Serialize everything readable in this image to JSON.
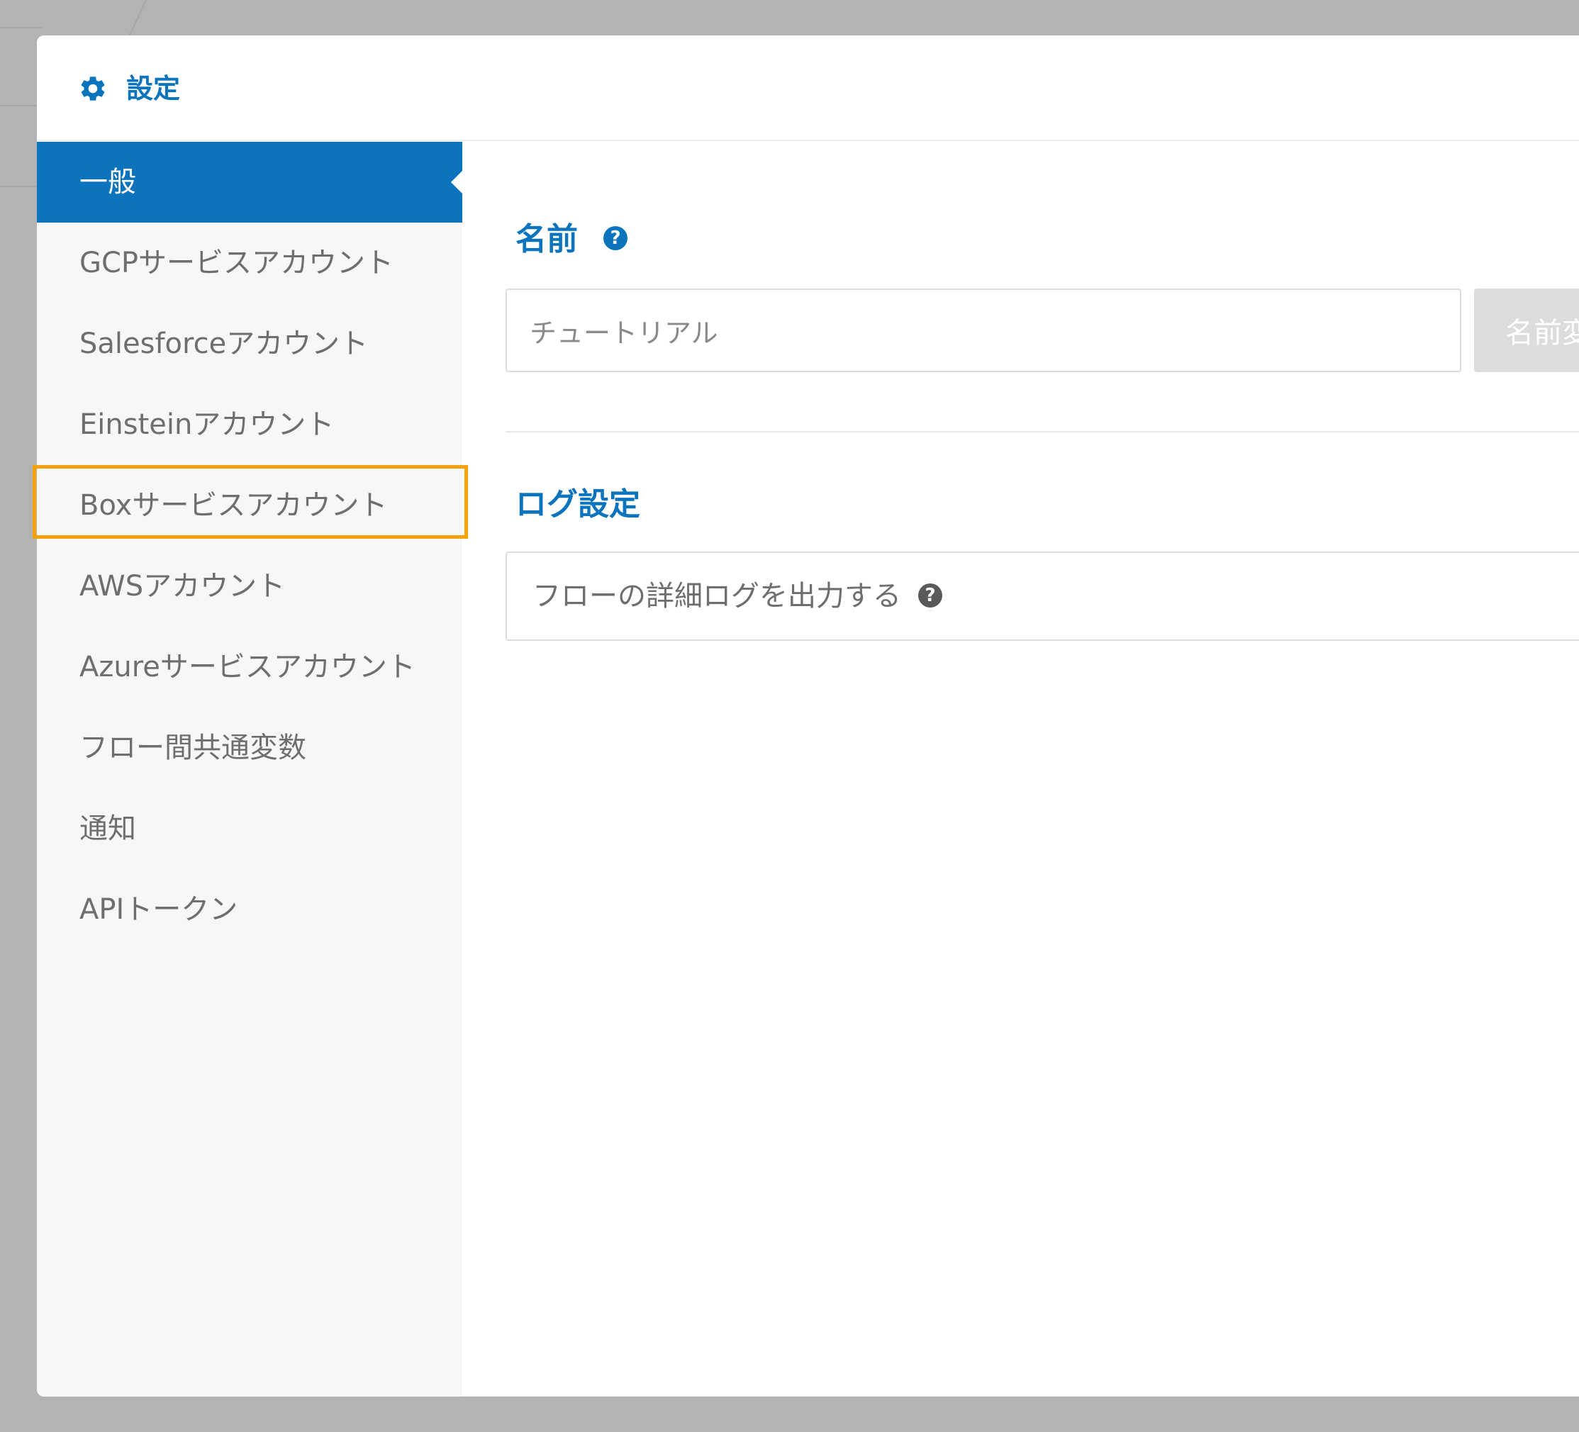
{
  "header": {
    "title": "設定",
    "icon": "gear-icon"
  },
  "sidebar": {
    "items": [
      {
        "label": "一般",
        "active": true
      },
      {
        "label": "GCPサービスアカウント",
        "active": false
      },
      {
        "label": "Salesforceアカウント",
        "active": false
      },
      {
        "label": "Einsteinアカウント",
        "active": false
      },
      {
        "label": "Boxサービスアカウント",
        "active": false,
        "highlighted": true
      },
      {
        "label": "AWSアカウント",
        "active": false
      },
      {
        "label": "Azureサービスアカウント",
        "active": false
      },
      {
        "label": "フロー間共通変数",
        "active": false
      },
      {
        "label": "通知",
        "active": false
      },
      {
        "label": "APIトークン",
        "active": false
      }
    ]
  },
  "main": {
    "name_section": {
      "title": "名前",
      "help": "?",
      "input_value": "チュートリアル",
      "rename_button_label": "名前変"
    },
    "log_section": {
      "title": "ログ設定",
      "option_label": "フローの詳細ログを出力する",
      "help": "?"
    }
  },
  "colors": {
    "accent": "#0c73bd",
    "highlight": "#f5a20a",
    "sidebar_bg": "#f7f7f7",
    "overlay": "#b3b3b3"
  }
}
